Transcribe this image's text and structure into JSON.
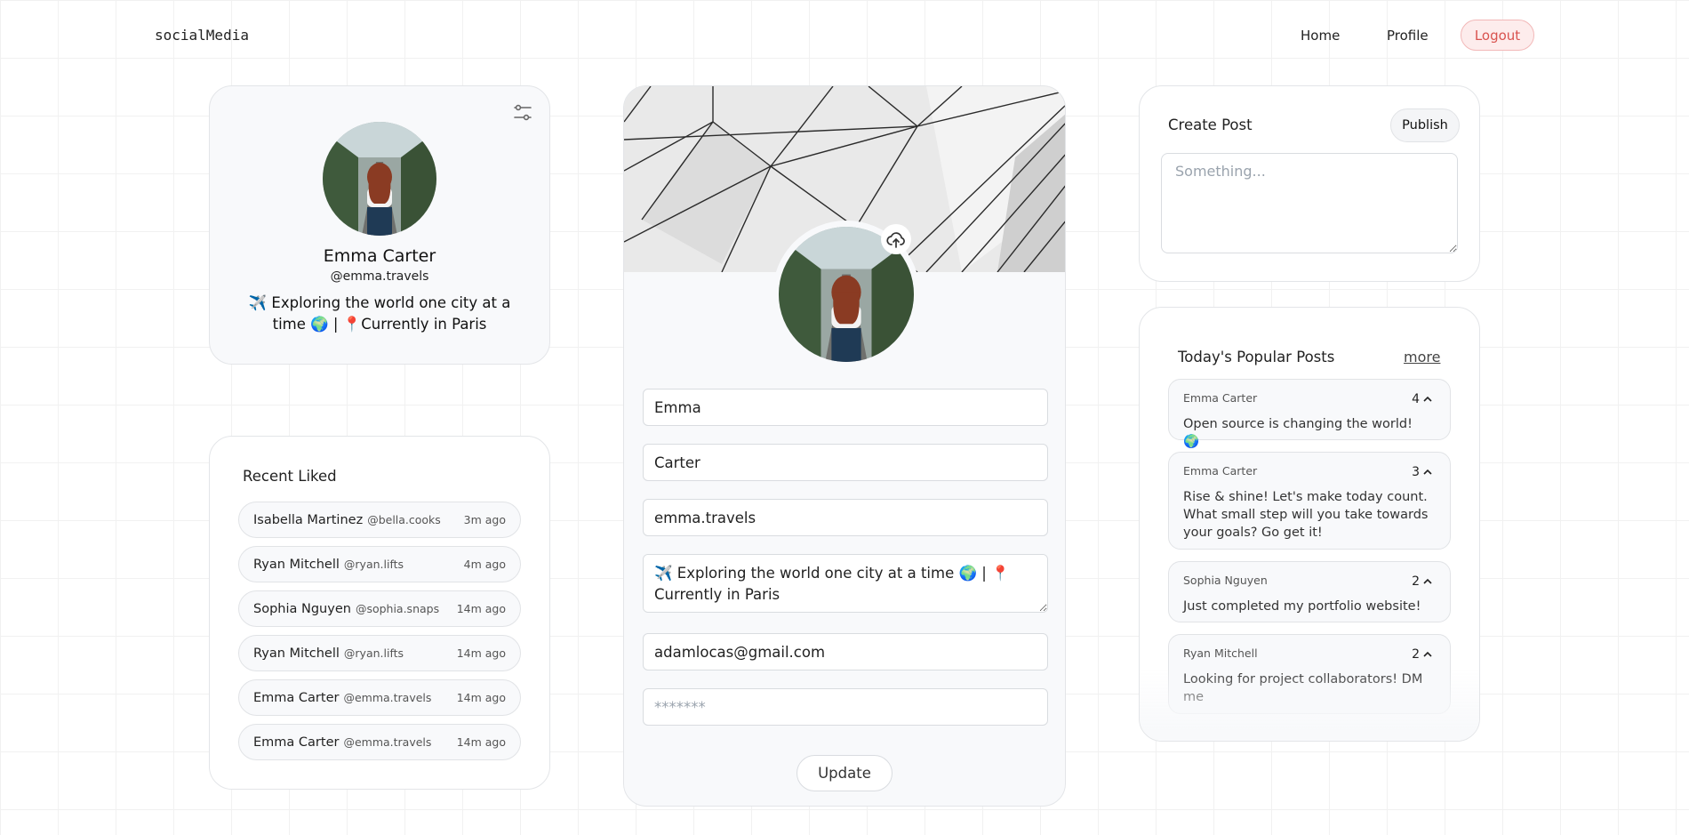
{
  "nav": {
    "brand": "socialMedia",
    "home": "Home",
    "profile": "Profile",
    "logout": "Logout"
  },
  "profile": {
    "name": "Emma Carter",
    "handle": "@emma.travels",
    "bio": "✈️ Exploring the world one city at a time 🌍 | 📍Currently in Paris"
  },
  "recent_liked": {
    "title": "Recent Liked",
    "items": [
      {
        "name": "Isabella Martinez",
        "handle": "@bella.cooks",
        "time": "3m ago"
      },
      {
        "name": "Ryan Mitchell",
        "handle": "@ryan.lifts",
        "time": "4m ago"
      },
      {
        "name": "Sophia Nguyen",
        "handle": "@sophia.snaps",
        "time": "14m ago"
      },
      {
        "name": "Ryan Mitchell",
        "handle": "@ryan.lifts",
        "time": "14m ago"
      },
      {
        "name": "Emma Carter",
        "handle": "@emma.travels",
        "time": "14m ago"
      },
      {
        "name": "Emma Carter",
        "handle": "@emma.travels",
        "time": "14m ago"
      }
    ]
  },
  "edit_form": {
    "first_name": "Emma",
    "last_name": "Carter",
    "username": "emma.travels",
    "bio": "✈️ Exploring the world one city at a time 🌍 | 📍 Currently in Paris",
    "email": "adamlocas@gmail.com",
    "password_placeholder": "*******",
    "update_label": "Update"
  },
  "create_post": {
    "title": "Create Post",
    "publish_label": "Publish",
    "placeholder": "Something..."
  },
  "popular": {
    "title": "Today's Popular Posts",
    "more_label": "more",
    "posts": [
      {
        "author": "Emma Carter",
        "count": "4",
        "text": "Open source is changing the world! 🌍"
      },
      {
        "author": "Emma Carter",
        "count": "3",
        "text": "Rise & shine! Let's make today count. What small step will you take towards your goals? Go get it!"
      },
      {
        "author": "Sophia Nguyen",
        "count": "2",
        "text": "Just completed my portfolio website!"
      },
      {
        "author": "Ryan Mitchell",
        "count": "2",
        "text": "Looking for project collaborators! DM me"
      }
    ]
  },
  "icons": {
    "filter": "sliders-icon",
    "upload": "cloud-upload-icon",
    "upvote": "chevron-up-icon"
  },
  "colors": {
    "logout_text": "#d9534f",
    "logout_bg": "#fdecec",
    "card_bg": "#f8f9fb"
  }
}
